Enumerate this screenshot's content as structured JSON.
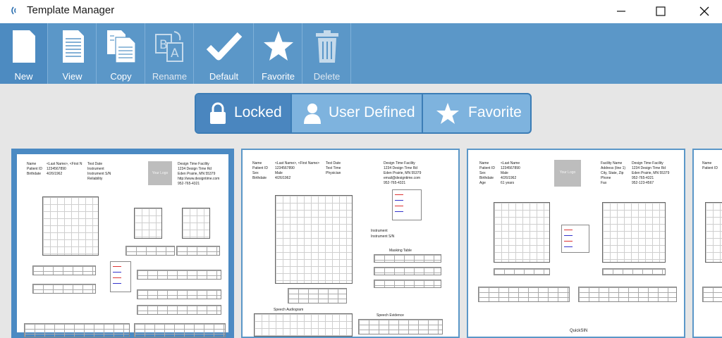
{
  "window": {
    "title": "Template Manager"
  },
  "toolbar": {
    "new_label": "New",
    "view_label": "View",
    "copy_label": "Copy",
    "rename_label": "Rename",
    "default_label": "Default",
    "favorite_label": "Favorite",
    "delete_label": "Delete"
  },
  "filter": {
    "locked_label": "Locked",
    "user_defined_label": "User Defined",
    "favorite_label": "Favorite",
    "active": "Locked"
  },
  "colors": {
    "accent": "#5b97c8",
    "accent_dark": "#3c7db6",
    "segment_active": "#4a86bf",
    "card_border": "#4b8ac3",
    "content_bg": "#e6e6e6"
  },
  "templates": [
    {
      "fields": [
        "Name",
        "<Last Name>, <First N",
        "Test Date",
        "Patient ID",
        "1234567890",
        "Instrument",
        "Birthdate",
        "4/26/1962",
        "Instrument S/N",
        "Reliability"
      ],
      "facility": [
        "Design Time Facility",
        "1234 Design Time Rd",
        "Eden Prairie, MN 55379",
        "http://www.designtime.com",
        "952-765-4321"
      ],
      "logo": "Your Logo",
      "bottom_label": ""
    },
    {
      "fields": [
        "Name",
        "<Last Name>, <First Name>",
        "Test Date",
        "Patient ID",
        "1234567890",
        "Test Time",
        "Sex",
        "Male",
        "Physician",
        "Birthdate",
        "4/26/1962"
      ],
      "facility": [
        "Design Time Facility",
        "1234 Design Time Rd",
        "Eden Prairie, MN 55379",
        "email@designtime.com",
        "952-765-4321"
      ],
      "logo": "",
      "extra": [
        "Instrument",
        "Instrument S/N",
        "Masking Table",
        "Speech Audiogram",
        "Speech Evidence"
      ],
      "bottom_label": ""
    },
    {
      "fields": [
        "Name",
        "<Last Name",
        "Patient ID",
        "1234567890",
        "Sex",
        "Male",
        "Birthdate",
        "4/26/1962",
        "Age",
        "61 years"
      ],
      "facility": [
        "Facility Name",
        "Design Time Facility",
        "Address (line 1)",
        "1234 Design Time Rd",
        "City, State, Zip",
        "Eden Prairie, MN 55379",
        "Phone",
        "952-765-4321",
        "Fax",
        "952-123-4567"
      ],
      "logo": "Your Logo",
      "bottom_label": "QuickSIN"
    }
  ]
}
